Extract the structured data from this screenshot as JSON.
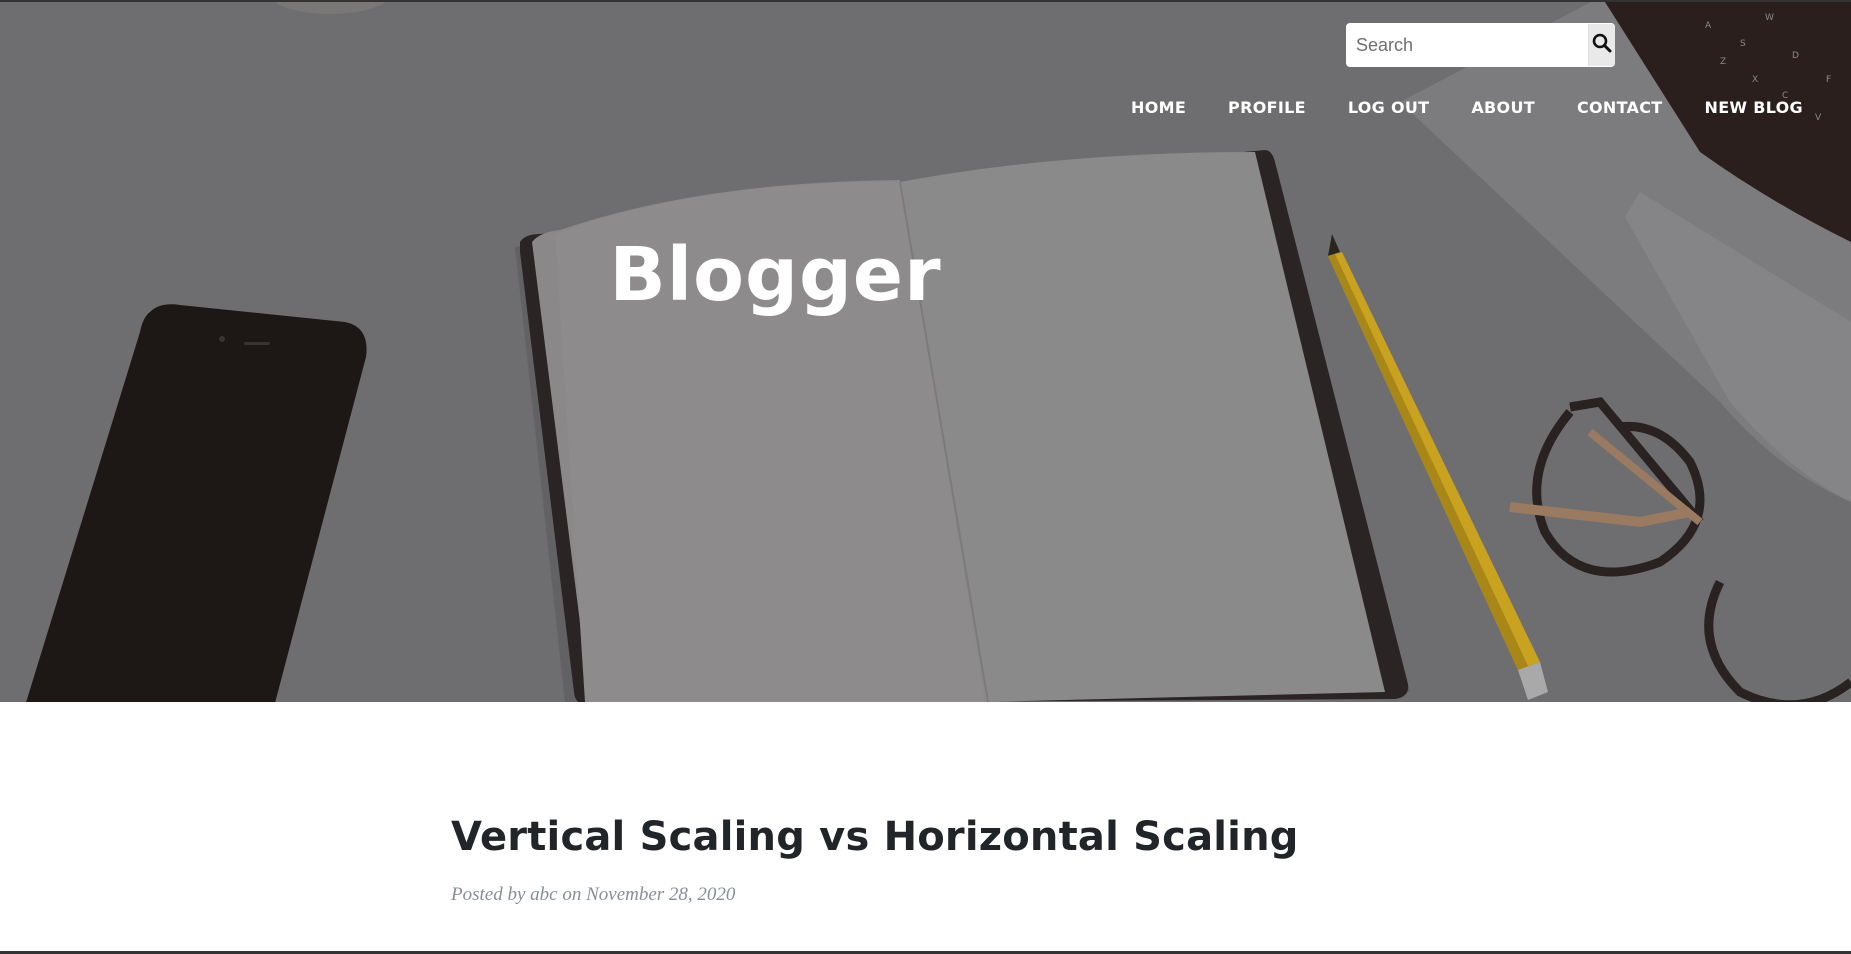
{
  "search": {
    "placeholder": "Search",
    "icon": "search-icon"
  },
  "nav": {
    "items": [
      {
        "label": "HOME"
      },
      {
        "label": "PROFILE"
      },
      {
        "label": "LOG OUT"
      },
      {
        "label": "ABOUT"
      },
      {
        "label": "CONTACT"
      },
      {
        "label": "NEW BLOG"
      }
    ]
  },
  "hero": {
    "title": "Blogger"
  },
  "post": {
    "title": "Vertical Scaling vs Horizontal Scaling",
    "meta_prefix": "Posted by",
    "author": "abc",
    "meta_on": "on",
    "date": "November 28, 2020"
  },
  "colors": {
    "hero_overlay": "#6c6c6e",
    "title_text": "#212529",
    "meta_text": "#868e96"
  }
}
